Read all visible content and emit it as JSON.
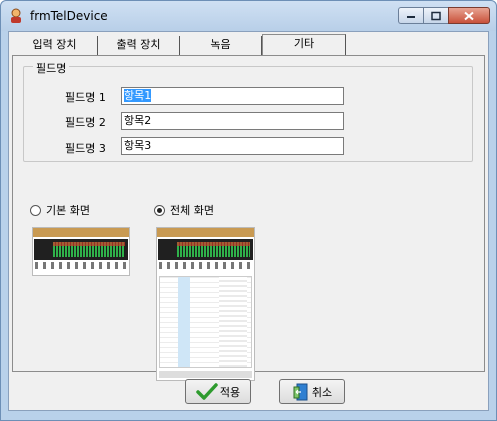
{
  "window": {
    "title": "frmTelDevice"
  },
  "tabs": [
    {
      "label": "입력 장치",
      "active": false
    },
    {
      "label": "출력 장치",
      "active": false
    },
    {
      "label": "녹음",
      "active": false
    },
    {
      "label": "기타",
      "active": true
    }
  ],
  "field_group": {
    "legend": "필드명",
    "fields": [
      {
        "label": "필드명 1",
        "value": "항목1",
        "selected": true
      },
      {
        "label": "필드명 2",
        "value": "항목2",
        "selected": false
      },
      {
        "label": "필드명 3",
        "value": "항목3",
        "selected": false
      }
    ]
  },
  "view_mode": {
    "options": [
      {
        "label": "기본 화면",
        "checked": false,
        "preview_icon": "basic-layout-thumbnail"
      },
      {
        "label": "전체 화면",
        "checked": true,
        "preview_icon": "full-layout-thumbnail"
      }
    ]
  },
  "buttons": {
    "apply_label": "적용",
    "cancel_label": "취소"
  },
  "colors": {
    "window_frame": "#b9d1ea",
    "selection": "#3399ff",
    "close_button": "#c8513a"
  }
}
